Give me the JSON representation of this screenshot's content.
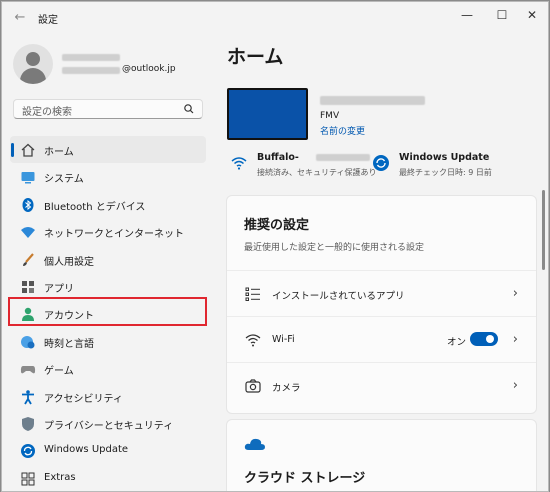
{
  "window": {
    "title": "設定"
  },
  "sidebar": {
    "profile": {
      "email_suffix": "@outlook.jp"
    },
    "search_placeholder": "設定の検索",
    "items": [
      {
        "label": "ホーム",
        "icon": "home-icon",
        "selected": true
      },
      {
        "label": "システム",
        "icon": "system-icon"
      },
      {
        "label": "Bluetooth とデバイス",
        "icon": "bluetooth-icon"
      },
      {
        "label": "ネットワークとインターネット",
        "icon": "network-icon"
      },
      {
        "label": "個人用設定",
        "icon": "brush-icon"
      },
      {
        "label": "アプリ",
        "icon": "apps-icon"
      },
      {
        "label": "アカウント",
        "icon": "account-icon",
        "highlighted": true
      },
      {
        "label": "時刻と言語",
        "icon": "globe-clock-icon"
      },
      {
        "label": "ゲーム",
        "icon": "game-icon"
      },
      {
        "label": "アクセシビリティ",
        "icon": "accessibility-icon"
      },
      {
        "label": "プライバシーとセキュリティ",
        "icon": "shield-icon"
      },
      {
        "label": "Windows Update",
        "icon": "update-icon"
      },
      {
        "label": "Extras",
        "icon": "extras-icon"
      }
    ]
  },
  "main": {
    "title": "ホーム",
    "device": {
      "model": "FMV",
      "rename_link": "名前の変更"
    },
    "status": {
      "wifi": {
        "title": "Buffalo-",
        "subtitle": "接続済み、セキュリティ保護あり"
      },
      "update": {
        "title": "Windows Update",
        "subtitle": "最終チェック日時: 9 日前"
      }
    },
    "recommended": {
      "title": "推奨の設定",
      "subtitle": "最近使用した設定と一般的に使用される設定",
      "rows": [
        {
          "label": "インストールされているアプリ",
          "icon": "list-icon"
        },
        {
          "label": "Wi-Fi",
          "icon": "wifi-icon",
          "toggle_label": "オン",
          "toggle_on": true
        },
        {
          "label": "カメラ",
          "icon": "camera-icon"
        }
      ]
    },
    "cloud": {
      "title": "クラウド ストレージ",
      "icon": "cloud-icon"
    }
  },
  "colors": {
    "accent": "#005fb8",
    "highlight": "#e0262f",
    "device": "#0a52a8"
  }
}
